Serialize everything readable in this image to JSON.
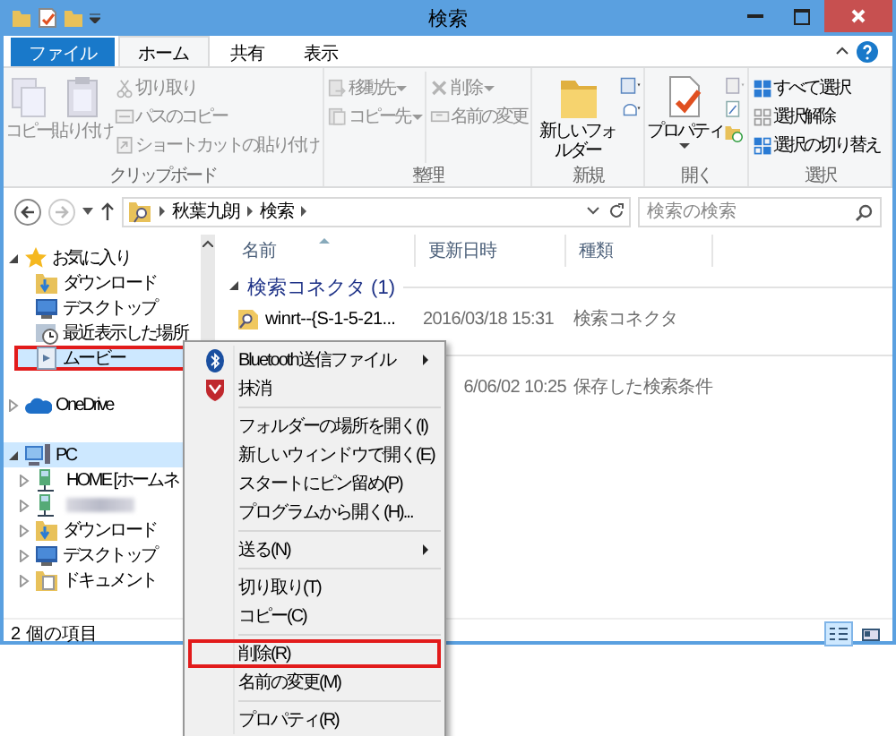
{
  "window": {
    "title": "検索"
  },
  "tabs": [
    {
      "label": "ファイル",
      "kind": "file",
      "selected": false
    },
    {
      "label": "ホーム",
      "kind": "tab",
      "selected": true
    },
    {
      "label": "共有",
      "kind": "tab",
      "selected": false
    },
    {
      "label": "表示",
      "kind": "tab",
      "selected": false
    }
  ],
  "ribbon": [
    {
      "label": "クリップボード",
      "items": [
        {
          "kind": "large",
          "label": "コピー",
          "disabled": true
        },
        {
          "kind": "large",
          "label": "貼り付け",
          "disabled": true
        },
        {
          "kind": "stack",
          "items": [
            {
              "label": "切り取り",
              "disabled": true,
              "dropdown": false
            },
            {
              "label": "パスのコピー",
              "disabled": true,
              "dropdown": false
            },
            {
              "label": "ショートカットの貼り付け",
              "disabled": true,
              "dropdown": false
            }
          ]
        }
      ]
    },
    {
      "label": "整理",
      "items": [
        {
          "kind": "stack",
          "items": [
            {
              "label": "移動先",
              "disabled": true,
              "dropdown": true
            },
            {
              "label": "コピー先",
              "disabled": true,
              "dropdown": true
            }
          ]
        },
        {
          "kind": "stack",
          "items": [
            {
              "label": "削除",
              "disabled": true,
              "dropdown": true
            },
            {
              "label": "名前の変更",
              "disabled": true,
              "dropdown": false
            }
          ]
        }
      ]
    },
    {
      "label": "新規",
      "items": [
        {
          "kind": "large",
          "label": "新しいフォルダー",
          "disabled": false
        }
      ]
    },
    {
      "label": "開く",
      "items": [
        {
          "kind": "large",
          "label": "プロパティ",
          "disabled": false,
          "dropdown": true
        }
      ]
    },
    {
      "label": "選択",
      "items": [
        {
          "kind": "stack",
          "items": [
            {
              "label": "すべて選択",
              "disabled": false,
              "dropdown": false
            },
            {
              "label": "選択解除",
              "disabled": false,
              "dropdown": false
            },
            {
              "label": "選択の切り替え",
              "disabled": false,
              "dropdown": false
            }
          ]
        }
      ]
    }
  ],
  "address": {
    "path": [
      "秋葉九朗",
      "検索"
    ]
  },
  "search": {
    "placeholder": "検索の検索"
  },
  "nav": {
    "items": [
      {
        "label": "お気に入り",
        "kind": "favorites",
        "expanded": true,
        "selected": false,
        "highlighted": false,
        "children": [
          {
            "label": "ダウンロード",
            "kind": "download",
            "selected": false,
            "highlighted": false
          },
          {
            "label": "デスクトップ",
            "kind": "desktop",
            "selected": false,
            "highlighted": false
          },
          {
            "label": "最近表示した場所",
            "kind": "recent",
            "selected": false,
            "highlighted": false
          },
          {
            "label": "ムービー",
            "kind": "library",
            "selected": true,
            "highlighted": true
          }
        ]
      },
      {
        "label": "OneDrive",
        "kind": "cloud",
        "expanded": false,
        "selected": false,
        "highlighted": false
      },
      {
        "label": "PC",
        "kind": "pc",
        "expanded": true,
        "selected": true,
        "highlighted": false,
        "children": [
          {
            "label": "HOME [ホームネ",
            "kind": "drive",
            "expanded": false,
            "selected": false,
            "highlighted": false
          },
          {
            "kind": "redacted",
            "expanded": false,
            "selected": false,
            "highlighted": false
          },
          {
            "label": "ダウンロード",
            "kind": "download",
            "expanded": false,
            "selected": false,
            "highlighted": false
          },
          {
            "label": "デスクトップ",
            "kind": "desktop",
            "expanded": false,
            "selected": false,
            "highlighted": false
          },
          {
            "label": "ドキュメント",
            "kind": "document",
            "expanded": false,
            "selected": false,
            "highlighted": false
          }
        ]
      }
    ]
  },
  "columns": [
    "名前",
    "更新日時",
    "種類"
  ],
  "groups": [
    {
      "label": "検索コネクタ (1)",
      "rows": [
        {
          "name": "winrt--{S-1-5-21...",
          "date": "2016/03/18 15:31",
          "type": "検索コネクタ"
        }
      ]
    },
    {
      "rows": [
        {
          "date": "6/06/02 10:25",
          "type": "保存した検索条件"
        }
      ]
    }
  ],
  "status_bar": {
    "text": "2 個の項目",
    "views": [
      {
        "kind": "details",
        "selected": true
      },
      {
        "kind": "tiles",
        "selected": false
      }
    ]
  },
  "context_menu": {
    "items": [
      {
        "kind": "item",
        "label": "Bluetooth送信ファイル",
        "submenu": true,
        "highlighted": false
      },
      {
        "kind": "item",
        "label": "抹消",
        "submenu": false,
        "highlighted": false
      },
      {
        "kind": "separator"
      },
      {
        "kind": "item",
        "label": "フォルダーの場所を開く(I)",
        "submenu": false,
        "highlighted": false
      },
      {
        "kind": "item",
        "label": "新しいウィンドウで開く(E)",
        "submenu": false,
        "highlighted": false
      },
      {
        "kind": "item",
        "label": "スタートにピン留め(P)",
        "submenu": false,
        "highlighted": false
      },
      {
        "kind": "item",
        "label": "プログラムから開く(H)...",
        "submenu": false,
        "highlighted": false
      },
      {
        "kind": "separator"
      },
      {
        "kind": "item",
        "label": "送る(N)",
        "submenu": true,
        "highlighted": false
      },
      {
        "kind": "separator"
      },
      {
        "kind": "item",
        "label": "切り取り(T)",
        "submenu": false,
        "highlighted": false
      },
      {
        "kind": "item",
        "label": "コピー(C)",
        "submenu": false,
        "highlighted": false
      },
      {
        "kind": "separator"
      },
      {
        "kind": "item",
        "label": "削除(R)",
        "submenu": false,
        "highlighted": true
      },
      {
        "kind": "item",
        "label": "名前の変更(M)",
        "submenu": false,
        "highlighted": false
      },
      {
        "kind": "separator"
      },
      {
        "kind": "item",
        "label": "プロパティ(R)",
        "submenu": false,
        "highlighted": false
      }
    ]
  }
}
